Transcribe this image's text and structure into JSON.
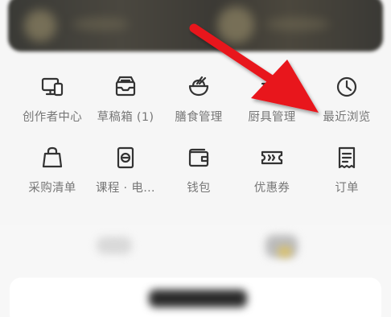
{
  "menu": {
    "row1": [
      {
        "label": "创作者中心",
        "icon": "creator-center-icon"
      },
      {
        "label": "草稿箱 (1)",
        "icon": "drafts-tray-icon"
      },
      {
        "label": "膳食管理",
        "icon": "meal-bowl-icon"
      },
      {
        "label": "厨具管理",
        "icon": "kitchenware-icon"
      },
      {
        "label": "最近浏览",
        "icon": "clock-icon"
      }
    ],
    "row2": [
      {
        "label": "采购清单",
        "icon": "shopping-bag-icon"
      },
      {
        "label": "课程 · 电…",
        "icon": "course-book-icon"
      },
      {
        "label": "钱包",
        "icon": "wallet-icon"
      },
      {
        "label": "优惠券",
        "icon": "coupon-ticket-icon"
      },
      {
        "label": "订单",
        "icon": "order-receipt-icon"
      }
    ]
  },
  "colors": {
    "label": "#777777",
    "icon": "#333333",
    "arrow": "#e8141c",
    "background": "#f6f6f6"
  }
}
